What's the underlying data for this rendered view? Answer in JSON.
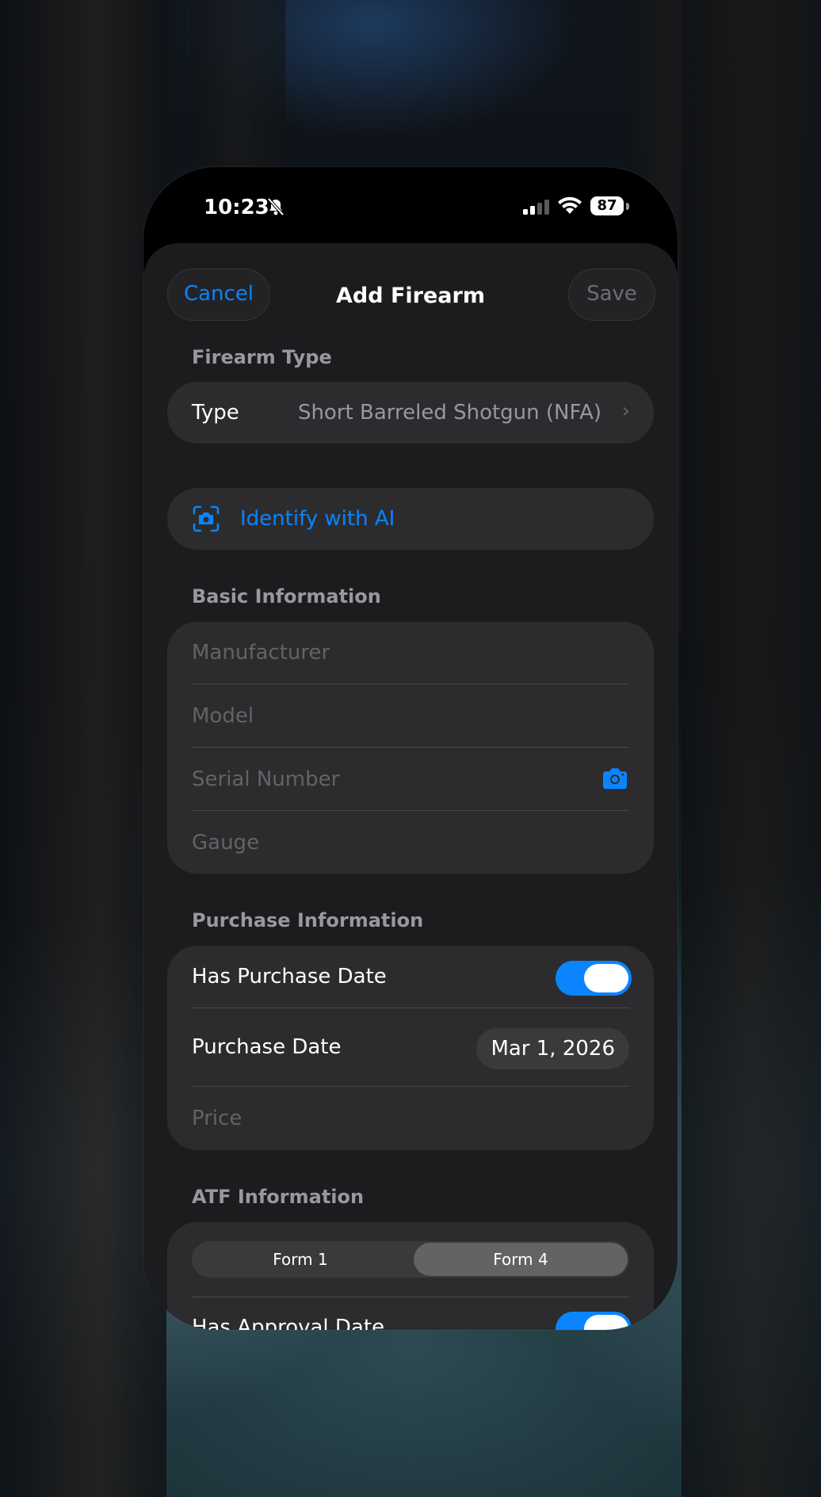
{
  "status_bar": {
    "time": "10:23",
    "battery": "87",
    "icons": [
      "bell-slash-icon",
      "cellular-signal-icon",
      "wifi-icon",
      "battery-icon"
    ]
  },
  "nav": {
    "cancel_label": "Cancel",
    "title": "Add Firearm",
    "save_label": "Save"
  },
  "firearm_type": {
    "section_label": "Firearm Type",
    "type_label": "Type",
    "type_value": "Short Barreled Shotgun (NFA)"
  },
  "identify": {
    "label": "Identify with AI",
    "icon": "camera-viewfinder-icon"
  },
  "basic_info": {
    "section_label": "Basic Information",
    "manufacturer_placeholder": "Manufacturer",
    "model_placeholder": "Model",
    "serial_placeholder": "Serial Number",
    "gauge_placeholder": "Gauge"
  },
  "purchase_info": {
    "section_label": "Purchase Information",
    "has_purchase_date_label": "Has Purchase Date",
    "has_purchase_date_on": true,
    "purchase_date_label": "Purchase Date",
    "purchase_date_value": "Mar 1, 2026",
    "price_placeholder": "Price"
  },
  "atf_info": {
    "section_label": "ATF Information",
    "segments": [
      "Form 1",
      "Form 4"
    ],
    "selected_segment": "Form 4",
    "has_approval_date_label": "Has Approval Date",
    "has_approval_date_on": true
  },
  "colors": {
    "accent": "#0a84ff",
    "sheet_bg": "#1c1c1e",
    "group_bg": "#2c2c2e"
  }
}
